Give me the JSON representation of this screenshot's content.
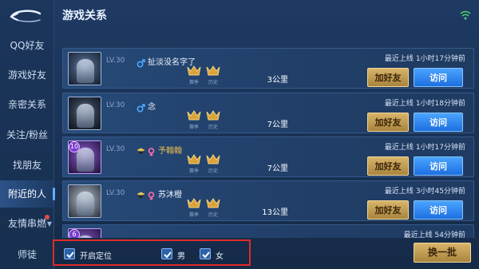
{
  "header": {
    "title": "游戏关系"
  },
  "sidebar": {
    "items": [
      {
        "label": "QQ好友"
      },
      {
        "label": "游戏好友"
      },
      {
        "label": "亲密关系"
      },
      {
        "label": "关注/粉丝"
      },
      {
        "label": "找朋友"
      },
      {
        "label": "附近的人",
        "active": true
      },
      {
        "label": "友情串燃"
      },
      {
        "label": "师徒"
      }
    ]
  },
  "list": {
    "add_friend_label": "加好友",
    "visit_label": "访问",
    "online_prefix": "最近上线",
    "medal_labels": [
      "赛季",
      "历史"
    ],
    "rows": [
      {
        "level": "LV.30",
        "gender": "male",
        "name": "扯淡没名字了",
        "distance": "3公里",
        "last_online": "1小时17分钟前",
        "avatar_style": "blue",
        "highlight_name": false
      },
      {
        "level": "LV.30",
        "gender": "male",
        "name": "念",
        "distance": "7公里",
        "last_online": "1小时18分钟前",
        "avatar_style": "dark",
        "highlight_name": false
      },
      {
        "level": "LV.30",
        "gender": "female",
        "name": "予翰翰",
        "distance": "7公里",
        "last_online": "1小时17分钟前",
        "avatar_style": "purple",
        "badge": "10",
        "highlight_name": true
      },
      {
        "level": "LV.30",
        "gender": "female",
        "name": "苏沐橙",
        "distance": "13公里",
        "last_online": "3小时45分钟前",
        "avatar_style": "gray",
        "highlight_name": false
      },
      {
        "level": "",
        "gender": "",
        "name": "",
        "distance": "",
        "last_online": "54分钟前",
        "avatar_style": "purple",
        "badge": "6",
        "highlight_name": false
      }
    ]
  },
  "filters": {
    "location": {
      "label": "开启定位",
      "checked": true
    },
    "male": {
      "label": "男",
      "checked": true
    },
    "female": {
      "label": "女",
      "checked": true
    }
  },
  "refresh_button": {
    "label": "换一批"
  },
  "colors": {
    "add_button": "#c9a55a",
    "visit_button": "#2f8cf5",
    "male": "#4aa8ff",
    "female": "#ff6fa8",
    "highlight": "#e02a2a"
  }
}
